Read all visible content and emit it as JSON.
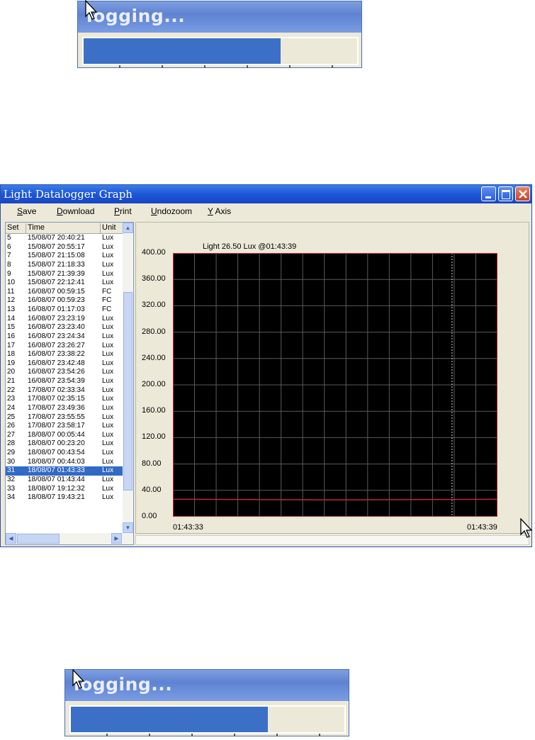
{
  "logging_dialog": {
    "label": "logging...",
    "progress_fraction": 0.72
  },
  "window": {
    "title": "Light Datalogger Graph"
  },
  "menu": [
    "Save",
    "Download",
    "Print",
    "Undozoom",
    "Y Axis"
  ],
  "list": {
    "headers": [
      "Set",
      "Time",
      "Unit"
    ],
    "rows": [
      [
        "5",
        "15/08/07 20:40:21",
        "Lux"
      ],
      [
        "6",
        "15/08/07 20:55:17",
        "Lux"
      ],
      [
        "7",
        "15/08/07 21:15:08",
        "Lux"
      ],
      [
        "8",
        "15/08/07 21:18:33",
        "Lux"
      ],
      [
        "9",
        "15/08/07 21:39:39",
        "Lux"
      ],
      [
        "10",
        "15/08/07 22:12:41",
        "Lux"
      ],
      [
        "11",
        "16/08/07 00:59:15",
        "FC"
      ],
      [
        "12",
        "16/08/07 00:59:23",
        "FC"
      ],
      [
        "13",
        "16/08/07 01:17:03",
        "FC"
      ],
      [
        "14",
        "16/08/07 23:23:19",
        "Lux"
      ],
      [
        "15",
        "16/08/07 23:23:40",
        "Lux"
      ],
      [
        "16",
        "16/08/07 23:24:34",
        "Lux"
      ],
      [
        "17",
        "16/08/07 23:26:27",
        "Lux"
      ],
      [
        "18",
        "16/08/07 23:38:22",
        "Lux"
      ],
      [
        "19",
        "16/08/07 23:42:48",
        "Lux"
      ],
      [
        "20",
        "16/08/07 23:54:26",
        "Lux"
      ],
      [
        "21",
        "16/08/07 23:54:39",
        "Lux"
      ],
      [
        "22",
        "17/08/07 02:33:34",
        "Lux"
      ],
      [
        "23",
        "17/08/07 02:35:15",
        "Lux"
      ],
      [
        "24",
        "17/08/07 23:49:36",
        "Lux"
      ],
      [
        "25",
        "17/08/07 23:55:55",
        "Lux"
      ],
      [
        "26",
        "17/08/07 23:58:17",
        "Lux"
      ],
      [
        "27",
        "18/08/07 00:05:44",
        "Lux"
      ],
      [
        "28",
        "18/08/07 00:23:20",
        "Lux"
      ],
      [
        "29",
        "18/08/07 00:43:54",
        "Lux"
      ],
      [
        "30",
        "18/08/07 00:44:03",
        "Lux"
      ],
      [
        "31",
        "18/08/07 01:43:33",
        "Lux"
      ],
      [
        "32",
        "18/08/07 01:43:44",
        "Lux"
      ],
      [
        "33",
        "18/08/07 19:12:32",
        "Lux"
      ],
      [
        "34",
        "18/08/07 19:43:21",
        "Lux"
      ]
    ],
    "selected_set": "31"
  },
  "graph": {
    "readout": "Light    26.50 Lux    @01:43:39"
  },
  "colors": {
    "plot_background": "#000000",
    "grid": "#5a5a5a",
    "series": "#c0282c",
    "cursor_line": "#d8d8d8",
    "selection": "#316ac5"
  },
  "chart_data": {
    "type": "line",
    "ylim": [
      0,
      400
    ],
    "y_ticks": [
      "0.00",
      "40.00",
      "80.00",
      "120.00",
      "160.00",
      "200.00",
      "240.00",
      "280.00",
      "320.00",
      "360.00",
      "400.00"
    ],
    "x_tick_labels": [
      "01:43:33",
      "01:43:39"
    ],
    "grid": true,
    "series": [
      {
        "x": [
          0,
          0.25,
          0.5,
          0.75,
          1.0
        ],
        "values": [
          26.5,
          26.0,
          25.5,
          26.0,
          26.5
        ]
      }
    ],
    "cursor_x": 0.86
  }
}
